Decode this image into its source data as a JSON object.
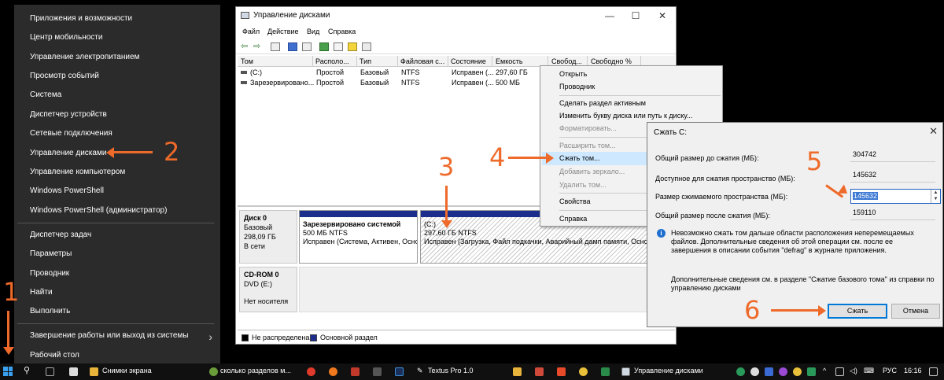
{
  "winx_menu": {
    "items": [
      "Приложения и возможности",
      "Центр мобильности",
      "Управление электропитанием",
      "Просмотр событий",
      "Система",
      "Диспетчер устройств",
      "Сетевые подключения",
      "Управление дисками",
      "Управление компьютером",
      "Windows PowerShell",
      "Windows PowerShell (администратор)",
      "Диспетчер задач",
      "Параметры",
      "Проводник",
      "Найти",
      "Выполнить",
      "Завершение работы или выход из системы",
      "Рабочий стол"
    ]
  },
  "disk_mgmt": {
    "title": "Управление дисками",
    "menu": [
      "Файл",
      "Действие",
      "Вид",
      "Справка"
    ],
    "columns": [
      "Том",
      "Располо...",
      "Тип",
      "Файловая с...",
      "Состояние",
      "Емкость",
      "Свобод...",
      "Свободно %"
    ],
    "volumes": [
      [
        "(C:)",
        "Простой",
        "Базовый",
        "NTFS",
        "Исправен (...",
        "297,60 ГБ"
      ],
      [
        "Зарезервировано...",
        "Простой",
        "Базовый",
        "NTFS",
        "Исправен (...",
        "500 МБ"
      ]
    ],
    "disk0": {
      "name": "Диск 0",
      "type": "Базовый",
      "size": "298,09 ГБ",
      "status": "В сети",
      "part1": {
        "name": "Зарезервировано системой",
        "size": "500 МБ NTFS",
        "status": "Исправен (Система, Активен, Осно"
      },
      "part2": {
        "name": "(C:)",
        "size": "297,60 ГБ NTFS",
        "status": "Исправен (Загрузка, Файл подкачки, Аварийный дамп памяти, Осно"
      }
    },
    "cdrom": {
      "name": "CD-ROM 0",
      "drive": "DVD (E:)",
      "status": "Нет носителя"
    },
    "legend": {
      "unallocated": "Не распределена",
      "primary": "Основной раздел"
    }
  },
  "context_menu": {
    "items": [
      "Открыть",
      "Проводник",
      "Сделать раздел активным",
      "Изменить букву диска или путь к диску...",
      "Форматировать...",
      "Расширить том...",
      "Сжать том...",
      "Добавить зеркало...",
      "Удалить том...",
      "Свойства",
      "Справка"
    ]
  },
  "shrink_dialog": {
    "title": "Сжать C:",
    "label_total_before": "Общий размер до сжатия (МБ):",
    "value_total_before": "304742",
    "label_available": "Доступное для сжатия пространство (МБ):",
    "value_available": "145632",
    "label_shrink_size": "Размер сжимаемого пространства (МБ):",
    "value_shrink_size": "145632",
    "label_total_after": "Общий размер после сжатия (МБ):",
    "value_total_after": "159110",
    "info_text": "Невозможно сжать том дальше области расположения неперемещаемых файлов. Дополнительные сведения об этой операции см. после ее завершения в описании события \"defrag\" в журнале приложения.",
    "more_info": "Дополнительные сведения см. в разделе \"Сжатие базового тома\" из справки по управлению дисками",
    "btn_shrink": "Сжать",
    "btn_cancel": "Отмена"
  },
  "annotations": [
    "1",
    "2",
    "3",
    "4",
    "5",
    "6"
  ],
  "taskbar": {
    "items": [
      "Снимки экрана",
      "сколько разделов м...",
      "Textus Pro 1.0",
      "Управление дисками"
    ],
    "lang": "РУС",
    "time": "16:16"
  },
  "colors": {
    "accent": "#ee6a2a",
    "primary_partition": "#1c2e8c",
    "selection": "#cde8ff"
  }
}
